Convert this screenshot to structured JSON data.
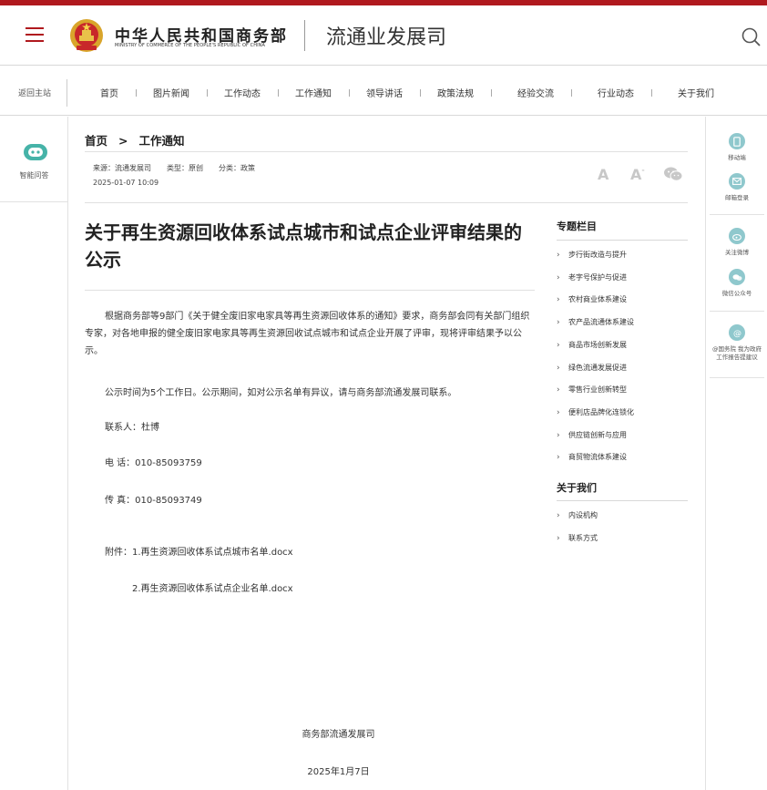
{
  "header": {
    "brand_cn": "中华人民共和国商务部",
    "brand_en": "MINISTRY OF COMMERCE OF THE PEOPLE'S REPUBLIC OF CHINA",
    "dept_name": "流通业发展司",
    "accent_color": "#b0191e"
  },
  "nav": {
    "back_home": "返回主站",
    "items": [
      "首页",
      "图片新闻",
      "工作动态",
      "工作通知",
      "领导讲话",
      "政策法规",
      "经验交流",
      "行业动态",
      "关于我们"
    ]
  },
  "left_rail": {
    "ai_label": "智能问答"
  },
  "right_rail": {
    "items": [
      {
        "icon": "mobile-icon",
        "label": "移动端"
      },
      {
        "icon": "mail-icon",
        "label": "邮箱登录"
      },
      {
        "icon": "weibo-icon",
        "label": "关注微博"
      },
      {
        "icon": "wechat-icon",
        "label": "微信公众号"
      },
      {
        "icon": "at-icon",
        "label_line1": "@国务院 我为政府",
        "label_line2": "工作报告提建议"
      }
    ]
  },
  "breadcrumb": {
    "home": "首页",
    "arrow": ">",
    "current": "工作通知"
  },
  "meta": {
    "source": "来源：流通发展司",
    "type": "类型：原创",
    "category": "分类：政策",
    "datetime": "2025-01-07 10:09",
    "font_large": "A",
    "font_small": "A",
    "font_small_mark": "-"
  },
  "article": {
    "title": "关于再生资源回收体系试点城市和试点企业评审结果的公示",
    "p1": "根据商务部等9部门《关于健全废旧家电家具等再生资源回收体系的通知》要求，商务部会同有关部门组织专家，对各地申报的健全废旧家电家具等再生资源回收试点城市和试点企业开展了评审，现将评审结果予以公示。",
    "p2": "公示时间为5个工作日。公示期间，如对公示名单有异议，请与商务部流通发展司联系。",
    "contact": "联系人：杜博",
    "phone": "电 话：010-85093759",
    "fax": "传 真：010-85093749",
    "attachment1": "附件：1.再生资源回收体系试点城市名单.docx",
    "attachment2": "2.再生资源回收体系试点企业名单.docx",
    "signature": "商务部流通发展司",
    "sign_date": "2025年1月7日"
  },
  "sidebar": {
    "topics_head": "专题栏目",
    "topics": [
      "步行街改造与提升",
      "老字号保护与促进",
      "农村商业体系建设",
      "农产品流通体系建设",
      "商品市场创新发展",
      "绿色流通发展促进",
      "零售行业创新转型",
      "便利店品牌化连锁化",
      "供应链创新与应用",
      "商贸物流体系建设"
    ],
    "about_head": "关于我们",
    "about": [
      "内设机构",
      "联系方式"
    ]
  }
}
